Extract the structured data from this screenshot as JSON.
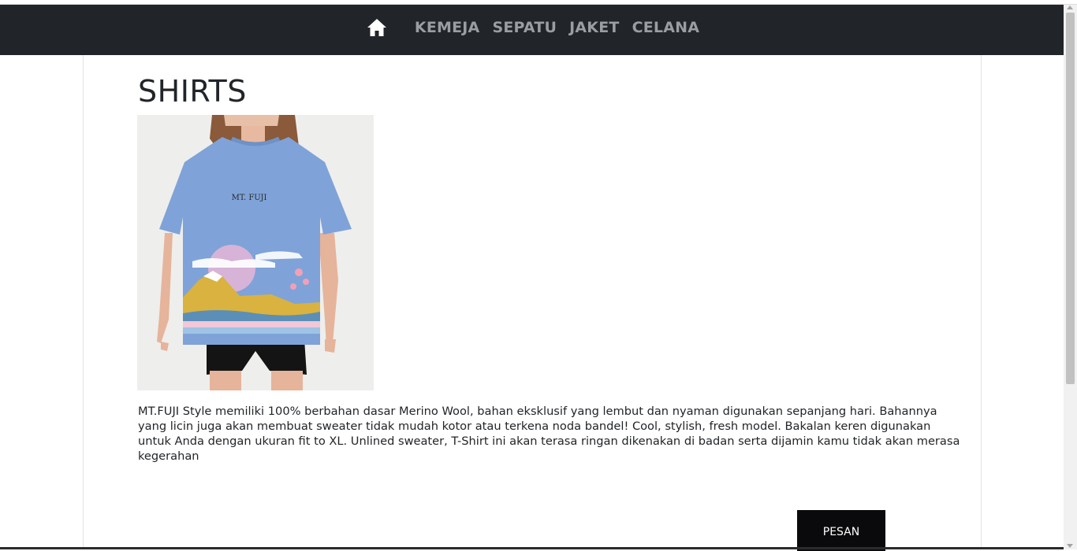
{
  "nav": {
    "home_icon": "home-icon",
    "links": [
      "KEMEJA",
      "SEPATU",
      "JAKET",
      "CELANA"
    ]
  },
  "product": {
    "title": "SHIRTS",
    "image_print_text": "MT. FUJI",
    "description": "MT.FUJI Style memiliki 100% berbahan dasar Merino Wool, bahan eksklusif yang lembut dan nyaman digunakan sepanjang hari. Bahannya yang licin juga akan membuat sweater tidak mudah kotor atau terkena noda bandel! Cool, stylish, fresh model. Bakalan keren digunakan untuk Anda dengan ukuran fit to XL. Unlined sweater, T-Shirt ini akan terasa ringan dikenakan di badan serta dijamin kamu tidak akan merasa kegerahan",
    "order_label": "PESAN"
  },
  "colors": {
    "navbar_bg": "#212529",
    "nav_link": "#9a9ea3",
    "button_bg": "#0a0a0c",
    "shirt_blue": "#7fa3d8"
  }
}
